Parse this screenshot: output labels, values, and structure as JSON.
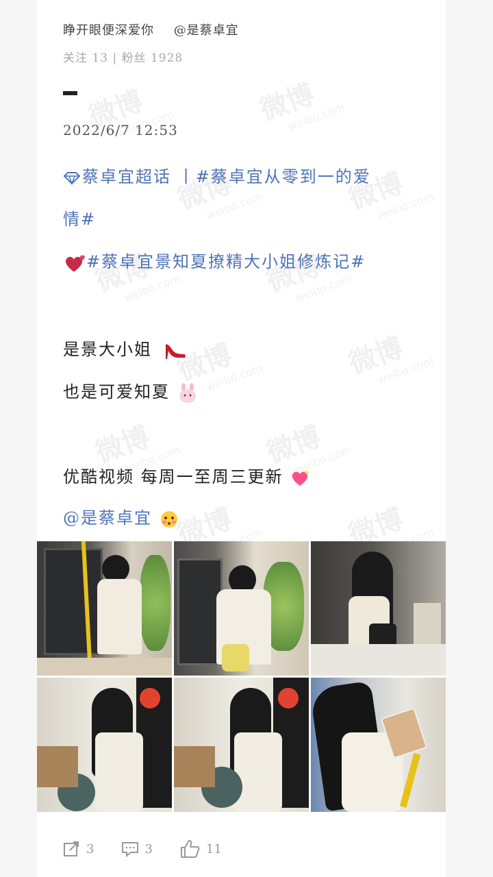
{
  "header": {
    "nickname": "睁开眼便深爱你",
    "mention": "@是蔡卓宜",
    "stats": "关注 13 | 粉丝 1928"
  },
  "post": {
    "date": "2022/6/7  12:53",
    "topic_line1": "蔡卓宜超话 丨#蔡卓宜从零到一的爱",
    "topic_line2": "情#",
    "topic_line3": "#蔡卓宜景知夏撩精大小姐修炼记#",
    "text1": "是景大小姐",
    "text2": "也是可爱知夏",
    "text3": "优酷视频 每周一至周三更新",
    "mention": "@是蔡卓宜"
  },
  "images": [
    "photo-1",
    "photo-2",
    "photo-3",
    "photo-4",
    "photo-5",
    "photo-6"
  ],
  "actions": {
    "repost_count": "3",
    "comment_count": "3",
    "like_count": "11"
  },
  "icons": {
    "topic": "diamond-icon",
    "heart": "two-hearts-emoji",
    "heel": "high-heel-emoji",
    "bunny": "bunny-emoji",
    "sparkle_heart": "sparkling-heart-emoji",
    "blush": "flushed-face-emoji",
    "repost": "repost-icon",
    "comment": "comment-icon",
    "like": "thumbs-up-icon"
  },
  "colors": {
    "link": "#4e74b8",
    "text": "#222222",
    "muted": "#a8a8a8"
  }
}
